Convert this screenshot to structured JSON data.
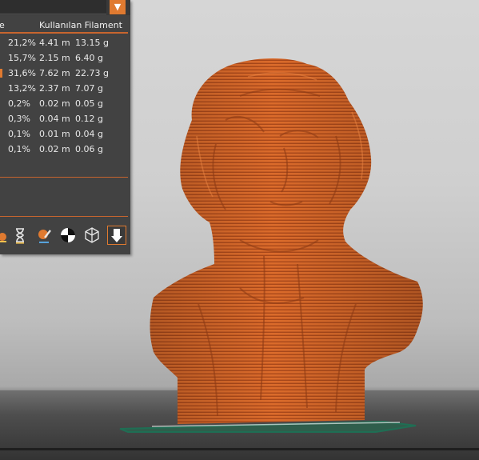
{
  "panel": {
    "header_left": "e",
    "header_right": "Kullanılan Filament",
    "dropdown_glyph": "▼",
    "rows": [
      {
        "percent": "21,2%",
        "length": "4.41 m",
        "weight": "13.15 g",
        "marked": false
      },
      {
        "percent": "15,7%",
        "length": "2.15 m",
        "weight": "6.40 g",
        "marked": false
      },
      {
        "percent": "31,6%",
        "length": "7.62 m",
        "weight": "22.73 g",
        "marked": true
      },
      {
        "percent": "13,2%",
        "length": "2.37 m",
        "weight": "7.07 g",
        "marked": false
      },
      {
        "percent": "0,2%",
        "length": "0.02 m",
        "weight": "0.05 g",
        "marked": false
      },
      {
        "percent": "0,3%",
        "length": "0.04 m",
        "weight": "0.12 g",
        "marked": false
      },
      {
        "percent": "0,1%",
        "length": "0.01 m",
        "weight": "0.04 g",
        "marked": false
      },
      {
        "percent": "0,1%",
        "length": "0.02 m",
        "weight": "0.06 g",
        "marked": false
      }
    ]
  },
  "toolbar": {
    "tools": [
      {
        "icon": "partial-tool-icon"
      },
      {
        "icon": "hourglass-icon"
      },
      {
        "icon": "paint-color-icon"
      },
      {
        "icon": "half-circle-view-icon"
      },
      {
        "icon": "wireframe-cube-icon"
      },
      {
        "icon": "arrow-down-active-icon"
      }
    ]
  },
  "colors": {
    "accent": "#e07a30",
    "model_orange": "#d9692a",
    "panel_bg": "#424242",
    "build_plate_outline": "#1f6e54"
  }
}
